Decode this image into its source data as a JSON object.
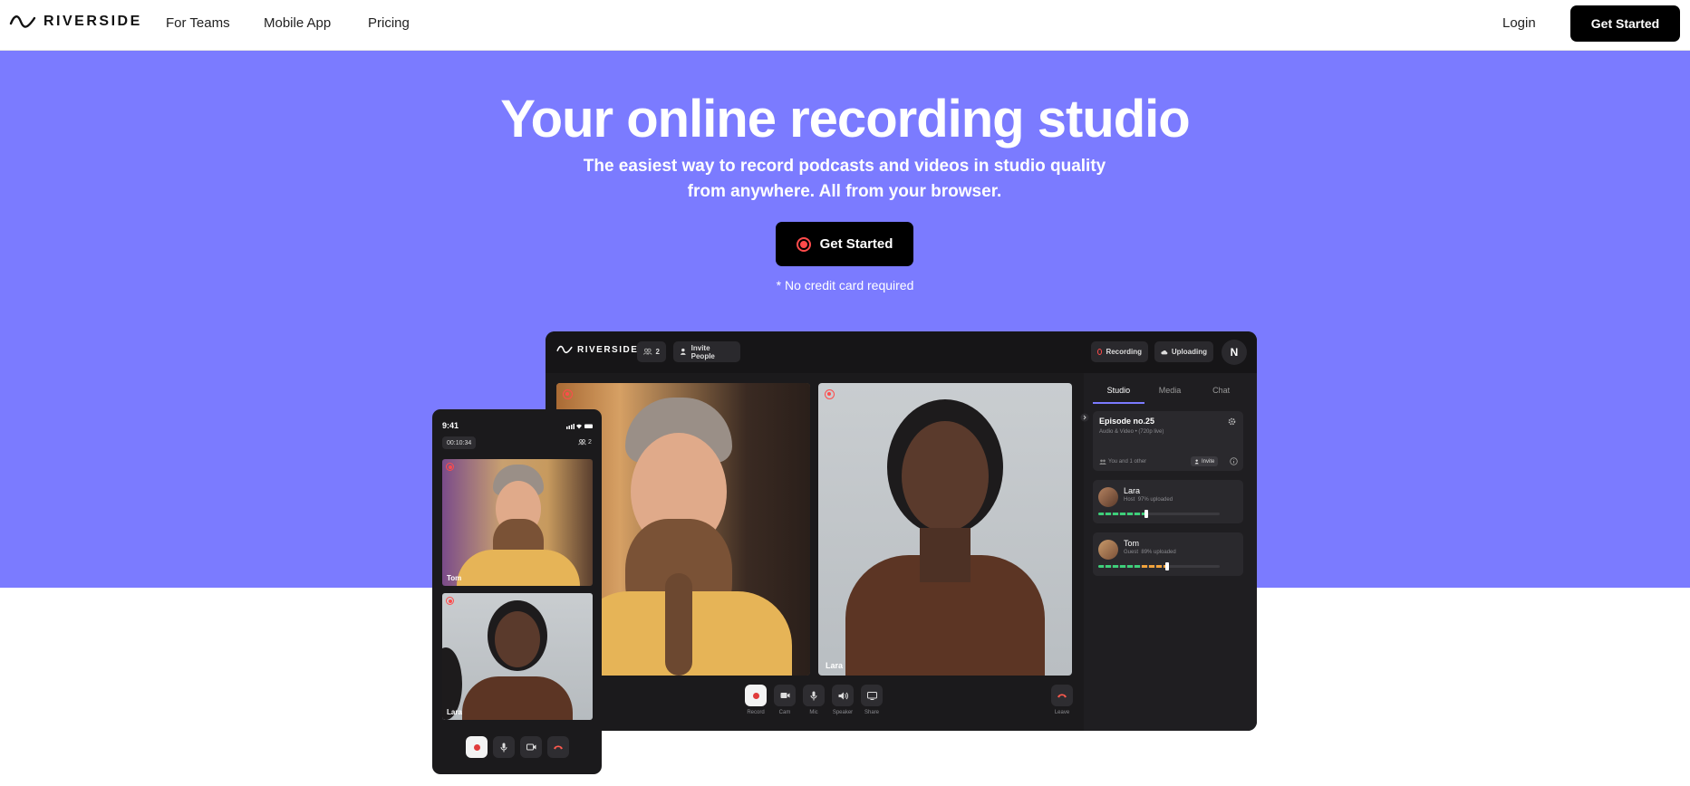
{
  "nav": {
    "brand": "RIVERSIDE",
    "links": [
      "For Teams",
      "Mobile App",
      "Pricing"
    ],
    "login": "Login",
    "cta": "Get Started"
  },
  "hero": {
    "title": "Your online recording studio",
    "subtitle_line1": "The easiest way to record podcasts and videos in studio quality",
    "subtitle_line2": "from anywhere. All from your browser.",
    "cta": "Get Started",
    "note": "* No credit card required",
    "background_color": "#7b7bff"
  },
  "app": {
    "brand": "RIVERSIDE",
    "participant_count": "2",
    "invite_label": "Invite People",
    "recording_label": "Recording",
    "uploading_label": "Uploading",
    "avatar_initial": "N",
    "tiles": [
      {
        "name": ""
      },
      {
        "name": "Lara"
      }
    ],
    "controls": [
      "Record",
      "Cam",
      "Mic",
      "Speaker",
      "Share"
    ],
    "leave_label": "Leave",
    "sidebar": {
      "tabs": [
        "Studio",
        "Media",
        "Chat"
      ],
      "episode_title": "Episode no.25",
      "episode_sub": "Audio & Video • (720p live)",
      "participants_text": "You and 1 other",
      "invite_label": "Invite",
      "people": [
        {
          "name": "Lara",
          "role": "Host",
          "upload": "97% uploaded",
          "level": 0.38
        },
        {
          "name": "Tom",
          "role": "Guest",
          "upload": "89% uploaded",
          "level": 0.55
        }
      ]
    }
  },
  "phone": {
    "time": "9:41",
    "timer": "00:10:34",
    "participant_count": "2",
    "tiles": [
      {
        "name": "Tom"
      },
      {
        "name": "Lara"
      }
    ]
  }
}
